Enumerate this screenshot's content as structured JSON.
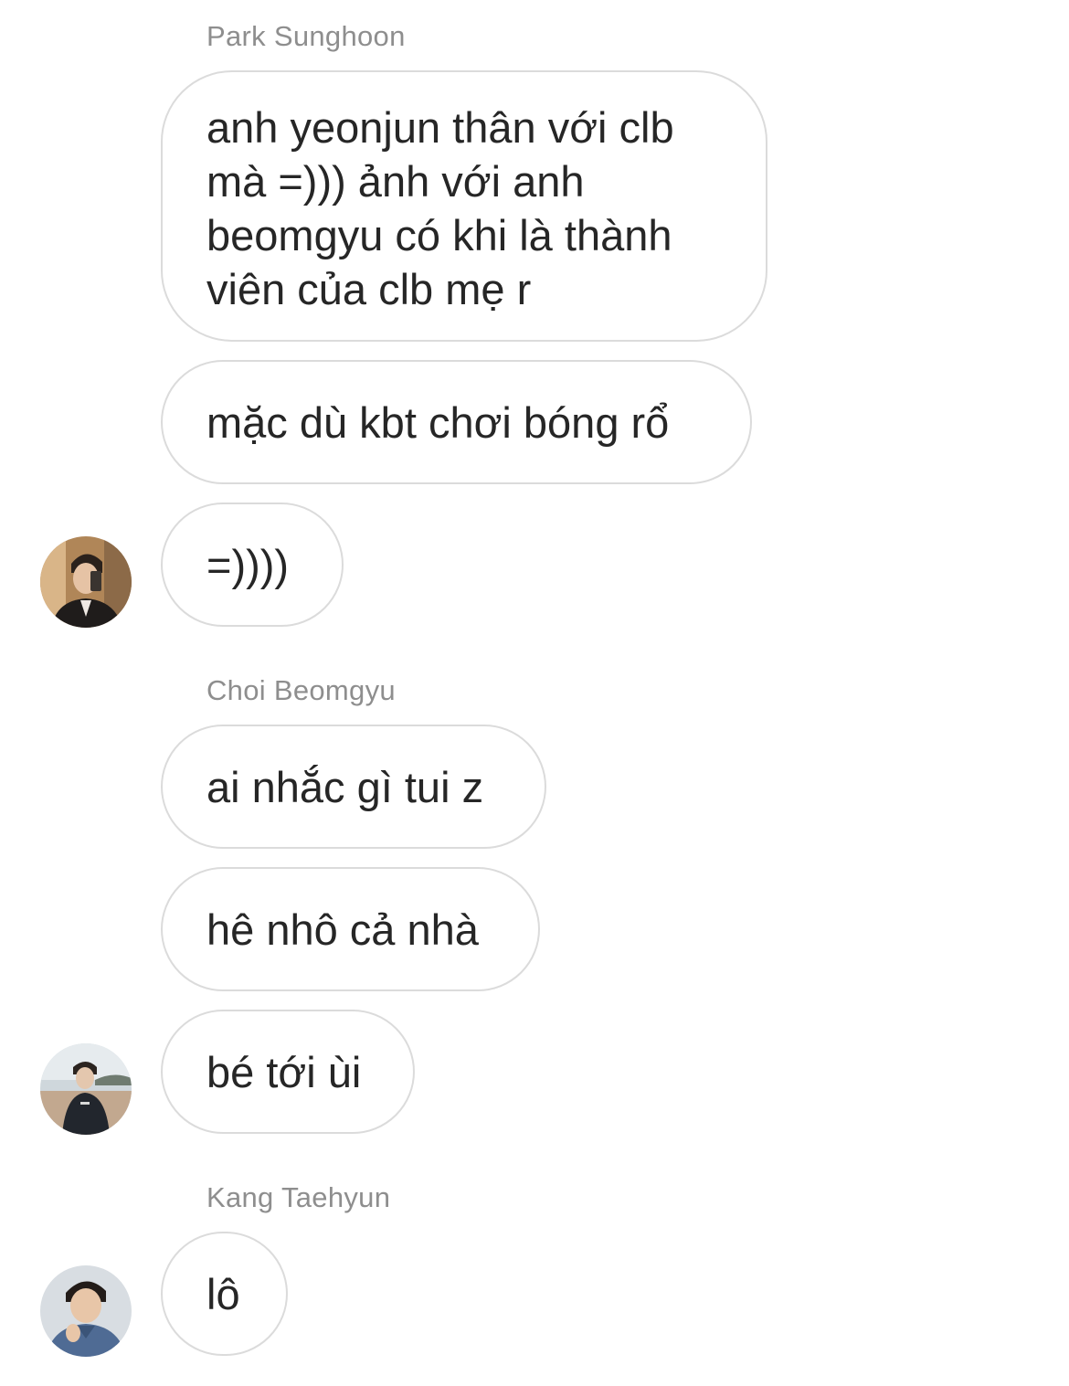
{
  "groups": [
    {
      "sender": "Park Sunghoon",
      "avatar_icon": "user-photo-avatar",
      "messages": [
        "anh yeonjun thân với clb mà =))) ảnh với anh beomgyu có khi là thành viên của clb mẹ r",
        "mặc dù kbt chơi bóng rổ",
        "=))))"
      ]
    },
    {
      "sender": "Choi Beomgyu",
      "avatar_icon": "user-photo-avatar",
      "messages": [
        "ai nhắc gì tui z",
        "hê nhô cả nhà",
        "bé tới ùi"
      ]
    },
    {
      "sender": "Kang Taehyun",
      "avatar_icon": "user-photo-avatar",
      "messages": [
        "lô"
      ]
    }
  ],
  "colors": {
    "bubble_border": "#dbdbdb",
    "sender_name": "#8e8e8e",
    "message_text": "#262626",
    "background": "#ffffff"
  }
}
